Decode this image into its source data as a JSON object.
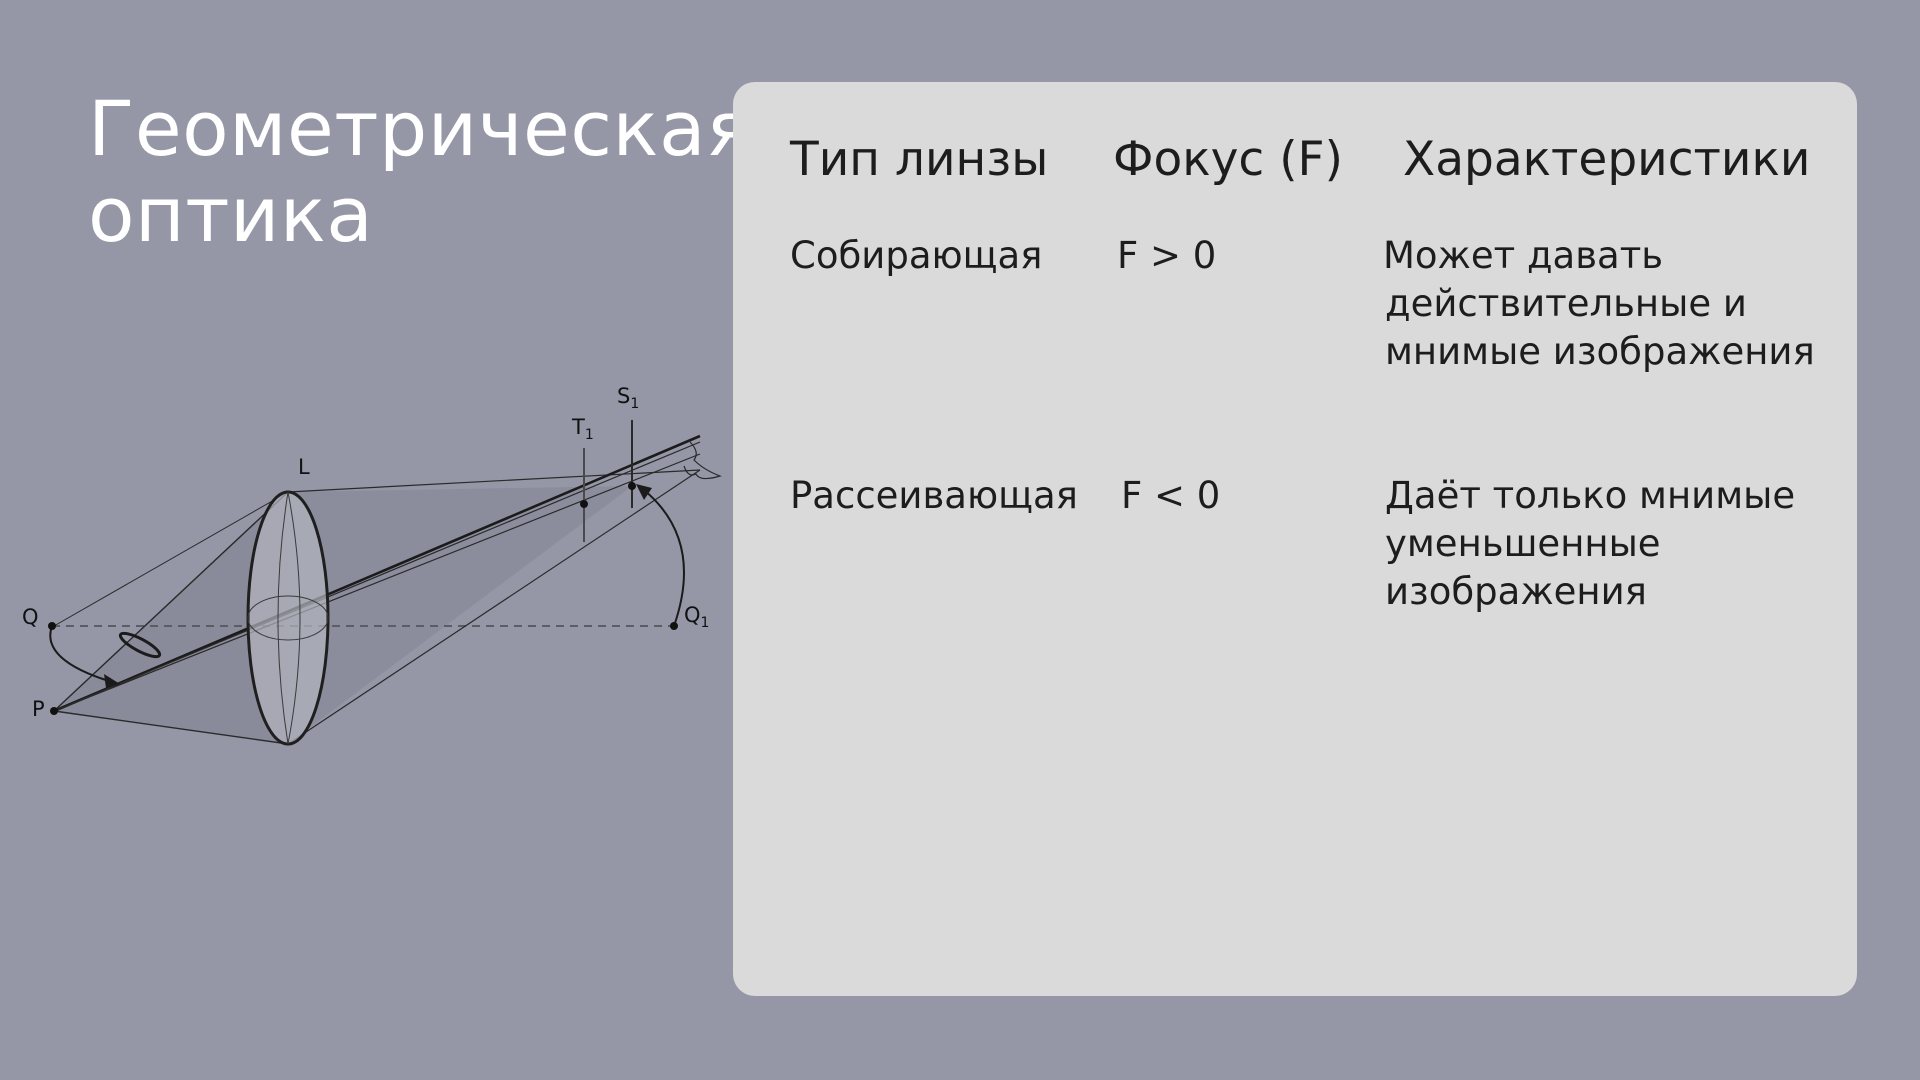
{
  "slide": {
    "title_line1": "Геометрическая",
    "title_line2": "оптика"
  },
  "diagram": {
    "labels": {
      "L": "L",
      "Q": "Q",
      "P": "P",
      "T1": "T",
      "T1_sub": "1",
      "S1": "S",
      "S1_sub": "1",
      "Q1": "Q",
      "Q1_sub": "1"
    }
  },
  "table": {
    "headers": [
      "Тип линзы",
      "Фокус (F)",
      "Характеристики"
    ],
    "rows": [
      {
        "type": "Собирающая",
        "focus": "F > 0",
        "characteristics": [
          "Может давать",
          "действительные и",
          "мнимые изображения"
        ]
      },
      {
        "type": "Рассеивающая",
        "focus": "F < 0",
        "characteristics": [
          "Даёт только мнимые",
          "уменьшенные",
          "изображения"
        ]
      }
    ]
  },
  "colors": {
    "background": "#9597a7",
    "card": "#dadada",
    "title": "#ffffff",
    "text": "#1d1d1d"
  }
}
